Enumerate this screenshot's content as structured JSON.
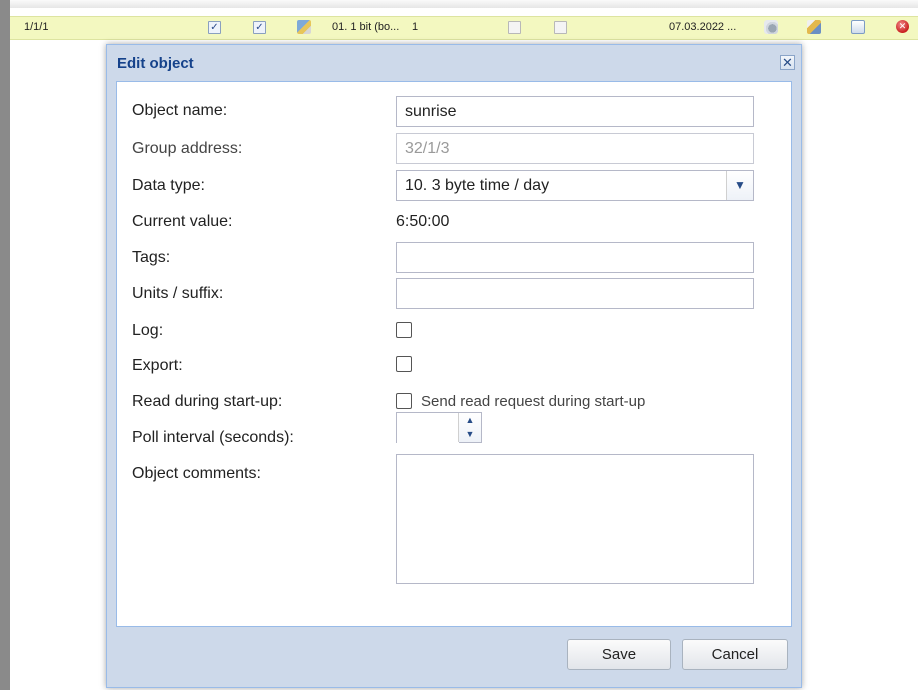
{
  "grid_row": {
    "address": "1/1/1",
    "col_a_checked": true,
    "col_b_checked": true,
    "datatype": "01. 1 bit (bo...",
    "value": "1",
    "col_c_checked": false,
    "col_d_checked": false,
    "updated": "07.03.2022 ...",
    "icons": [
      "edit-icon",
      "gear-icon",
      "pencil-icon",
      "document-icon",
      "delete-icon"
    ]
  },
  "dialog": {
    "title": "Edit object",
    "close_symbol": "✕",
    "fields": {
      "object_name": {
        "label": "Object name:",
        "value": "sunrise"
      },
      "group_address": {
        "label": "Group address:",
        "value": "32/1/3"
      },
      "data_type": {
        "label": "Data type:",
        "value": "10. 3 byte time / day"
      },
      "current_value": {
        "label": "Current value:",
        "value": "6:50:00"
      },
      "tags": {
        "label": "Tags:",
        "value": ""
      },
      "units": {
        "label": "Units / suffix:",
        "value": ""
      },
      "log": {
        "label": "Log:",
        "checked": false
      },
      "export": {
        "label": "Export:",
        "checked": false
      },
      "read_startup": {
        "label": "Read during start-up:",
        "checkbox_label": "Send read request during start-up",
        "checked": false
      },
      "poll_interval": {
        "label": "Poll interval (seconds):",
        "value": ""
      },
      "comments": {
        "label": "Object comments:",
        "value": ""
      }
    },
    "buttons": {
      "save": "Save",
      "cancel": "Cancel"
    }
  },
  "colors": {
    "row_highlight": "#f3f8c0",
    "dialog_frame": "#cdd9ea",
    "title_text": "#15428b",
    "border": "#99bbe8"
  }
}
